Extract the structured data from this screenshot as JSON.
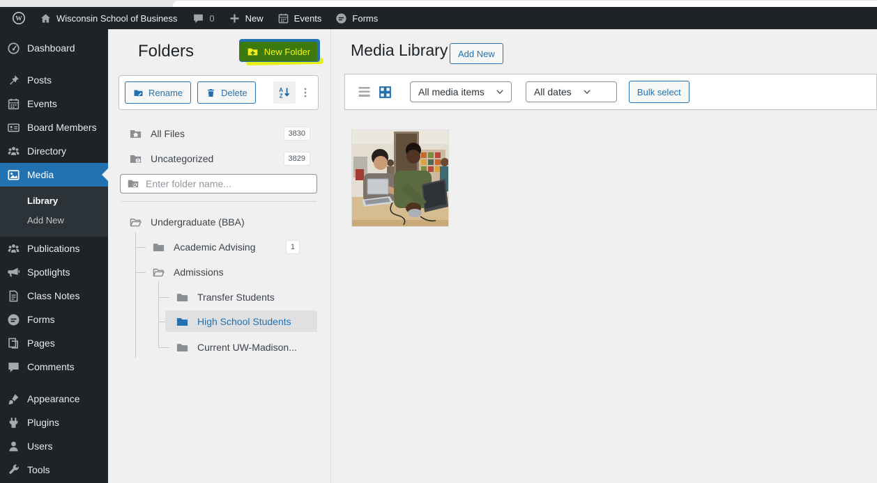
{
  "admin_bar": {
    "site_name": "Wisconsin School of Business",
    "comment_count": "0",
    "new_label": "New",
    "events_label": "Events",
    "forms_label": "Forms"
  },
  "sidebar": {
    "items": [
      {
        "label": "Dashboard",
        "icon": "dashboard-icon"
      },
      {
        "label": "Posts",
        "icon": "pin-icon"
      },
      {
        "label": "Events",
        "icon": "calendar-icon"
      },
      {
        "label": "Board Members",
        "icon": "id-card-icon"
      },
      {
        "label": "Directory",
        "icon": "groups-icon"
      },
      {
        "label": "Media",
        "icon": "media-icon"
      },
      {
        "label": "Publications",
        "icon": "groups-icon"
      },
      {
        "label": "Spotlights",
        "icon": "megaphone-icon"
      },
      {
        "label": "Class Notes",
        "icon": "document-icon"
      },
      {
        "label": "Forms",
        "icon": "gravityforms-icon"
      },
      {
        "label": "Pages",
        "icon": "pages-icon"
      },
      {
        "label": "Comments",
        "icon": "comment-icon"
      },
      {
        "label": "Appearance",
        "icon": "brush-icon"
      },
      {
        "label": "Plugins",
        "icon": "plugin-icon"
      },
      {
        "label": "Users",
        "icon": "user-icon"
      },
      {
        "label": "Tools",
        "icon": "wrench-icon"
      }
    ],
    "media_submenu": [
      {
        "label": "Library",
        "current": true
      },
      {
        "label": "Add New",
        "current": false
      }
    ]
  },
  "folders_panel": {
    "title": "Folders",
    "new_folder_label": "New Folder",
    "rename_label": "Rename",
    "delete_label": "Delete",
    "search_placeholder": "Enter folder name...",
    "special_items": [
      {
        "label": "All Files",
        "count": "3830",
        "icon": "folder-home-icon"
      },
      {
        "label": "Uncategorized",
        "count": "3829",
        "icon": "folder-alert-icon"
      }
    ],
    "tree": [
      {
        "label": "Undergraduate (BBA)",
        "depth": 0,
        "icon": "folder-open-icon"
      },
      {
        "label": "Academic Advising",
        "depth": 1,
        "icon": "folder-icon",
        "count": "1"
      },
      {
        "label": "Admissions",
        "depth": 1,
        "icon": "folder-open-icon"
      },
      {
        "label": "Transfer Students",
        "depth": 2,
        "icon": "folder-icon"
      },
      {
        "label": "High School Students",
        "depth": 2,
        "icon": "folder-icon",
        "selected": true
      },
      {
        "label": "Current UW-Madison...",
        "depth": 2,
        "icon": "folder-icon"
      }
    ]
  },
  "media": {
    "title": "Media Library",
    "add_new_label": "Add New",
    "media_filter_value": "All media items",
    "date_filter_value": "All dates",
    "bulk_select_label": "Bulk select",
    "items": [
      {
        "name": "students-at-laptops-photo"
      }
    ]
  },
  "colors": {
    "accent_blue": "#2271b1",
    "admin_dark": "#1d2327",
    "content_bg": "#f0f0f1",
    "highlight_yellow": "#e8ef13",
    "highlight_green": "#3c7a10"
  }
}
